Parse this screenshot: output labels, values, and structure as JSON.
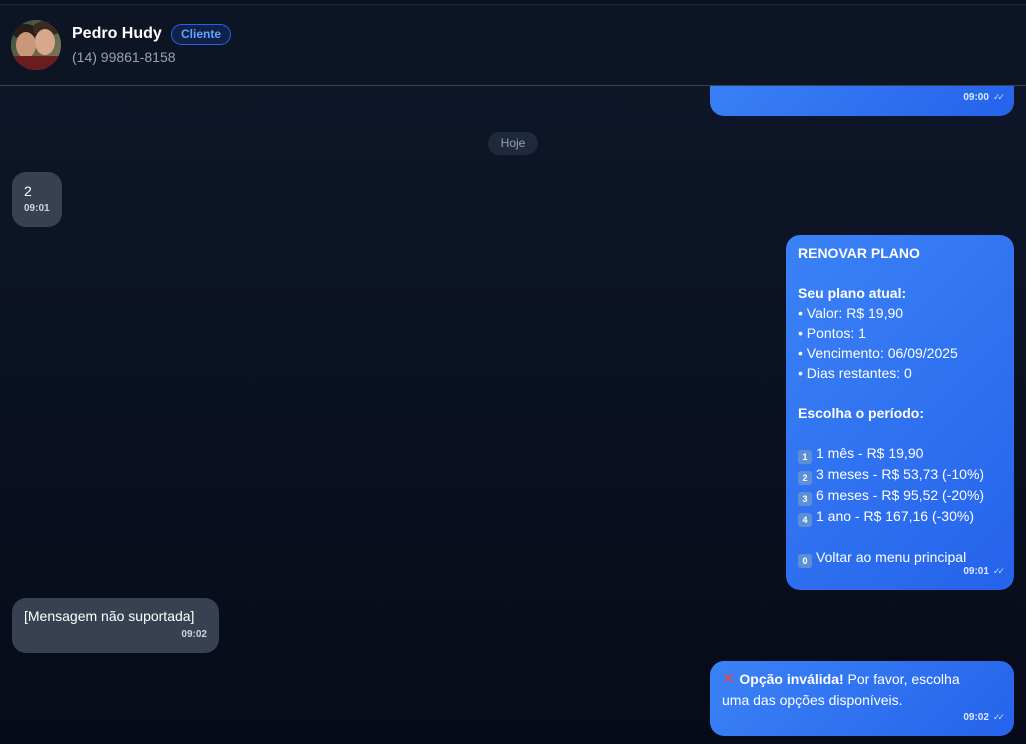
{
  "header": {
    "contact_name": "Pedro Hudy",
    "badge": "Cliente",
    "phone": "(14) 99861-8158"
  },
  "date_divider": "Hoje",
  "messages": [
    {
      "direction": "out",
      "time": "09:00",
      "status": "read"
    },
    {
      "direction": "in",
      "text": "2",
      "time": "09:01"
    },
    {
      "direction": "out",
      "time": "09:01",
      "status": "read",
      "title": "RENOVAR PLANO",
      "section_current": "Seu plano atual:",
      "details": [
        "• Valor: R$ 19,90",
        "• Pontos: 1",
        "• Vencimento: 06/09/2025",
        "• Dias restantes: 0"
      ],
      "section_choose": "Escolha o período:",
      "options": [
        {
          "key": "1",
          "label": "1 mês - R$ 19,90"
        },
        {
          "key": "2",
          "label": "3 meses - R$ 53,73 (-10%)"
        },
        {
          "key": "3",
          "label": "6 meses - R$ 95,52 (-20%)"
        },
        {
          "key": "4",
          "label": "1 ano - R$ 167,16 (-30%)"
        }
      ],
      "back_option": {
        "key": "0",
        "label": "Voltar ao menu principal"
      }
    },
    {
      "direction": "in",
      "text": "[Mensagem não suportada]",
      "time": "09:02"
    },
    {
      "direction": "out",
      "time": "09:02",
      "status": "read",
      "bold": "Opção inválida!",
      "text_line1": " Por favor, escolha",
      "text_line2": "uma das opções disponíveis."
    }
  ],
  "colors": {
    "background": "#0b1223",
    "outgoing_bubble": "#3b82f6",
    "incoming_bubble": "#374151",
    "badge_accent": "#60a5fa",
    "invalid_icon": "#ef4444"
  },
  "icons": [
    "avatar-photo",
    "double-check-icon",
    "keycap-number-icon",
    "cross-mark-icon"
  ]
}
